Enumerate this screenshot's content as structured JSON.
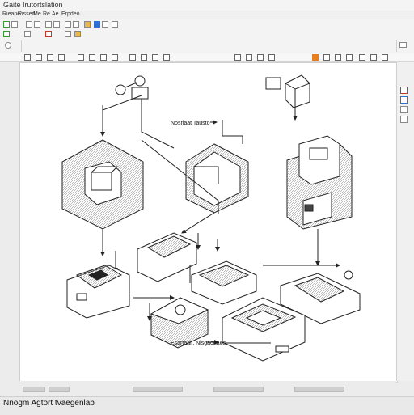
{
  "window": {
    "title": "Gaite Irutortslation"
  },
  "menu": {
    "items": [
      "Rieane",
      "Rissed",
      "Me",
      "Re",
      "Ae",
      "Erpdeo"
    ]
  },
  "canvas": {
    "callouts": [
      "Nosriaat Tausto",
      "Esartaall, Nisgaonaes"
    ]
  },
  "status": {
    "text": "Nnogm Agtort tvaegenlab"
  },
  "colors": {
    "accent_red": "#c0392b",
    "accent_orange": "#e67e22",
    "accent_blue": "#2e6fd0",
    "accent_green": "#3a9a3a"
  }
}
